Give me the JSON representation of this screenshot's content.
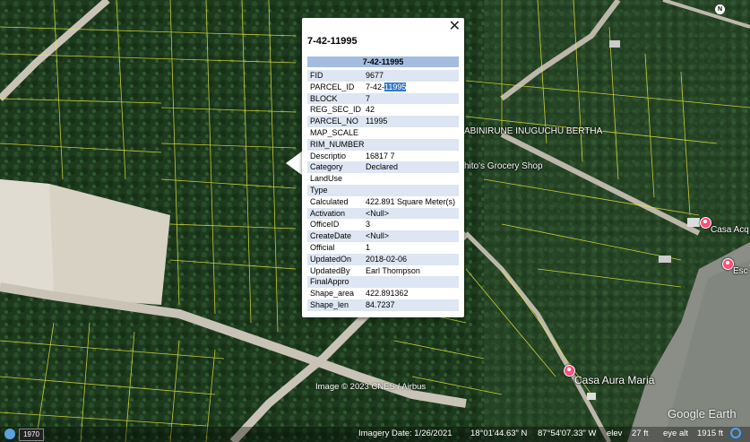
{
  "popup": {
    "title": "7-42-11995",
    "header": "7-42-11995",
    "close_icon": "close-icon",
    "attributes": [
      {
        "key": "FID",
        "value": "9677"
      },
      {
        "key": "PARCEL_ID",
        "value_prefix": "7-42-",
        "value_selected": "11995"
      },
      {
        "key": "BLOCK",
        "value": "7"
      },
      {
        "key": "REG_SEC_ID",
        "value": "42"
      },
      {
        "key": "PARCEL_NO",
        "value": "11995"
      },
      {
        "key": "MAP_SCALE",
        "value": ""
      },
      {
        "key": "RIM_NUMBER",
        "value": ""
      },
      {
        "key": "Descriptio",
        "value": "16817 7"
      },
      {
        "key": "Category",
        "value": "Declared"
      },
      {
        "key": "LandUse",
        "value": ""
      },
      {
        "key": "Type",
        "value": ""
      },
      {
        "key": "Calculated",
        "value": "422.891 Square Meter(s)"
      },
      {
        "key": "Activation",
        "value": "<Null>"
      },
      {
        "key": "OfficeID",
        "value": "3"
      },
      {
        "key": "CreateDate",
        "value": "<Null>"
      },
      {
        "key": "Official",
        "value": "1"
      },
      {
        "key": "UpdatedOn",
        "value": "2018-02-06"
      },
      {
        "key": "UpdatedBy",
        "value": "Earl Thompson"
      },
      {
        "key": "FinalAppro",
        "value": ""
      },
      {
        "key": "Shape_area",
        "value": "422.891362"
      },
      {
        "key": "Shape_len",
        "value": "84.7237"
      }
    ]
  },
  "map_labels": {
    "owner": "ABINIRUNE INUGUCHU BERTHA",
    "grocery": "hito's Grocery Shop",
    "casa_acq": "Casa Acq",
    "esc": "Esc",
    "casa_aura": "Casa Aura Maria"
  },
  "attribution": "Image © 2023 CNES / Airbus",
  "logo": "Google Earth",
  "compass_letter": "N",
  "status": {
    "year": "1970",
    "imagery_date": "Imagery Date: 1/26/2021",
    "lat": "18°01'44.63\" N",
    "lon": "87°54'07.33\" W",
    "elev_label": "elev",
    "elev": "27 ft",
    "eye_alt": "eye alt",
    "eye_alt_value": "1915 ft"
  },
  "colors": {
    "parcel_lines": "#e8e53a",
    "pin": "#ff4f7a",
    "header_bg": "#a3bde0"
  }
}
